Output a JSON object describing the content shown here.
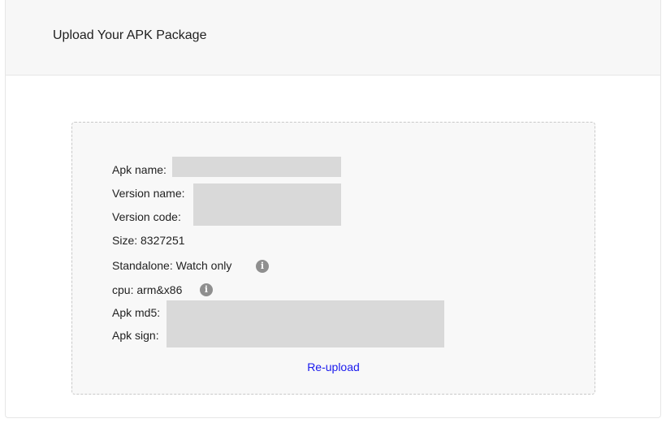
{
  "header": {
    "title": "Upload Your APK Package"
  },
  "apk_info": {
    "apk_name_label": "Apk name:",
    "version_name_label": "Version name:",
    "version_code_label": "Version code:",
    "size_label": "Size:",
    "size_value": "8327251",
    "standalone_label": "Standalone:",
    "standalone_value": "Watch only",
    "cpu_label": "cpu:",
    "cpu_value": "arm&x86",
    "apk_md5_label": "Apk md5:",
    "apk_sign_label": "Apk sign:"
  },
  "actions": {
    "reupload_label": "Re-upload"
  },
  "icons": {
    "info": "info-icon"
  },
  "colors": {
    "link": "#1a1aee",
    "header_bg": "#f7f7f7",
    "zone_bg": "#f8f8f8",
    "redaction": "#d9d9d9",
    "info_icon": "#8f8f8f"
  }
}
